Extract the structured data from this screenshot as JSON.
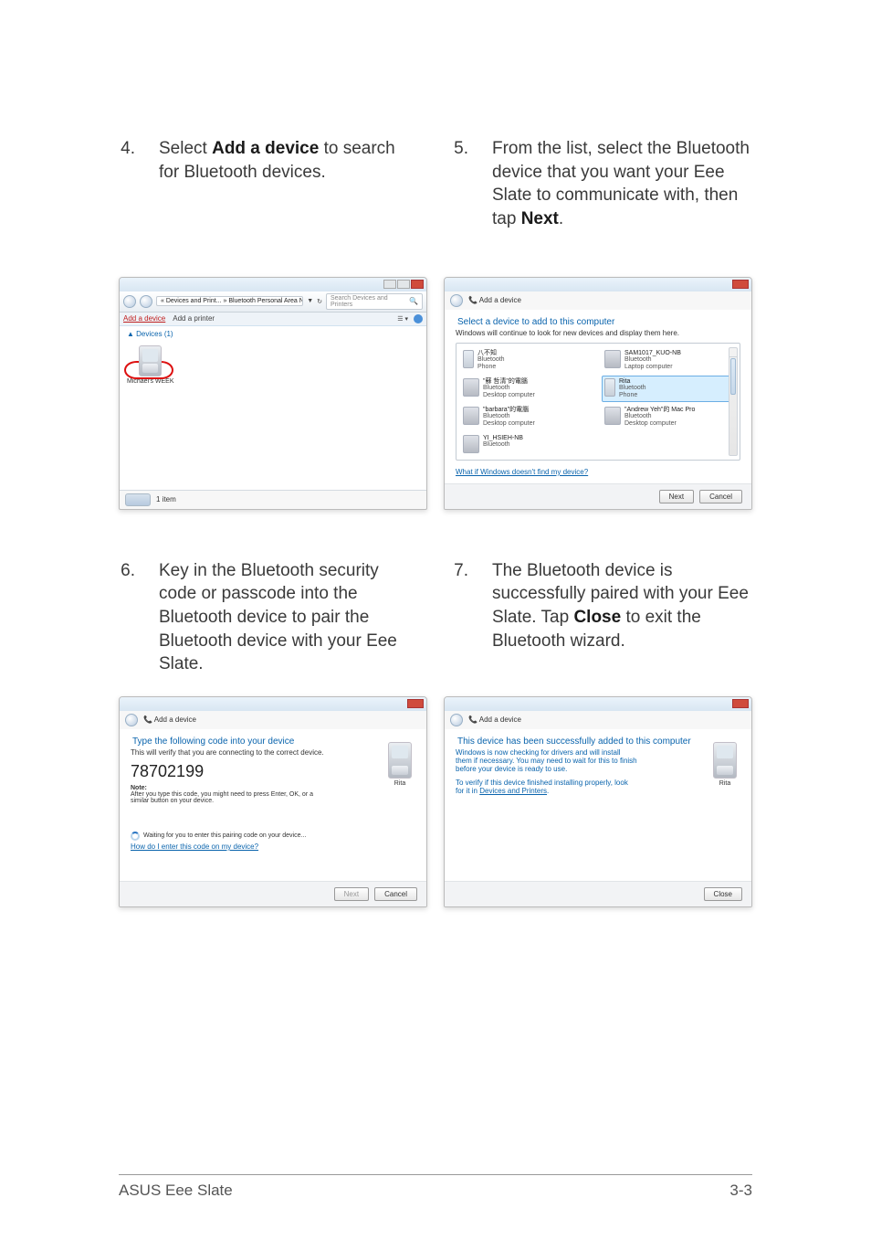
{
  "steps": {
    "s4_num": "4.",
    "s4_text_a": "Select ",
    "s4_text_b": "Add a device",
    "s4_text_c": " to search for Bluetooth devices.",
    "s5_num": "5.",
    "s5_text_a": "From the list, select the Bluetooth device that you want your Eee Slate to communicate with, then tap ",
    "s5_text_b": "Next",
    "s5_text_c": ".",
    "s6_num": "6.",
    "s6_text": "Key in the Bluetooth security code or passcode into the Bluetooth device to pair the Bluetooth device with your Eee Slate.",
    "s7_num": "7.",
    "s7_text_a": "The Bluetooth device is successfully paired with your Eee Slate. Tap ",
    "s7_text_b": "Close",
    "s7_text_c": " to exit the Bluetooth wizard."
  },
  "scr4": {
    "breadcrumb": "« Devices and Print... » Bluetooth Personal Area Network Devices",
    "search_placeholder": "Search Devices and Printers",
    "toolbar": {
      "add_device": "Add a device",
      "add_printer": "Add a printer"
    },
    "section_header": "▲ Devices (1)",
    "device_name": "Michael's WEEK",
    "status_text": "1 item"
  },
  "scr5": {
    "wizard_title": "Add a device",
    "heading": "Select a device to add to this computer",
    "sub": "Windows will continue to look for new devices and display them here.",
    "devices": [
      {
        "name": "八不知",
        "type": "Bluetooth",
        "category": "Phone"
      },
      {
        "name": "SAM1017_KUO-NB",
        "type": "Bluetooth",
        "category": "Laptop computer"
      },
      {
        "name": "\"蘇 哲清\"的電腦",
        "type": "Bluetooth",
        "category": "Desktop computer"
      },
      {
        "name": "Rita",
        "type": "Bluetooth",
        "category": "Phone"
      },
      {
        "name": "\"barbara\"的電腦",
        "type": "Bluetooth",
        "category": "Desktop computer"
      },
      {
        "name": "\"Andrew Yeh\"的 Mac Pro",
        "type": "Bluetooth",
        "category": "Desktop computer"
      },
      {
        "name": "YI_HSIEH-NB",
        "type": "Bluetooth",
        "category": ""
      }
    ],
    "help_link": "What if Windows doesn't find my device?",
    "btn_next": "Next",
    "btn_cancel": "Cancel"
  },
  "scr6": {
    "wizard_title": "Add a device",
    "heading": "Type the following code into your device",
    "sub": "This will verify that you are connecting to the correct device.",
    "code": "78702199",
    "note_label": "Note:",
    "note_text": "After you type this code, you might need to press Enter, OK, or a similar button on your device.",
    "waiting_text": "Waiting for you to enter this pairing code on your device...",
    "help_link": "How do I enter this code on my device?",
    "phone_caption": "Rita",
    "btn_next": "Next",
    "btn_cancel": "Cancel"
  },
  "scr7": {
    "wizard_title": "Add a device",
    "heading": "This device has been successfully added to this computer",
    "para1": "Windows is now checking for drivers and will install them if necessary. You may need to wait for this to finish before your device is ready to use.",
    "para2_a": "To verify if this device finished installing properly, look for it in ",
    "para2_link": "Devices and Printers",
    "para2_b": ".",
    "phone_caption": "Rita",
    "btn_close": "Close"
  },
  "footer": {
    "left": "ASUS Eee Slate",
    "right": "3-3"
  },
  "icons": {
    "arrow_down": "▼",
    "mag": "🔍"
  }
}
